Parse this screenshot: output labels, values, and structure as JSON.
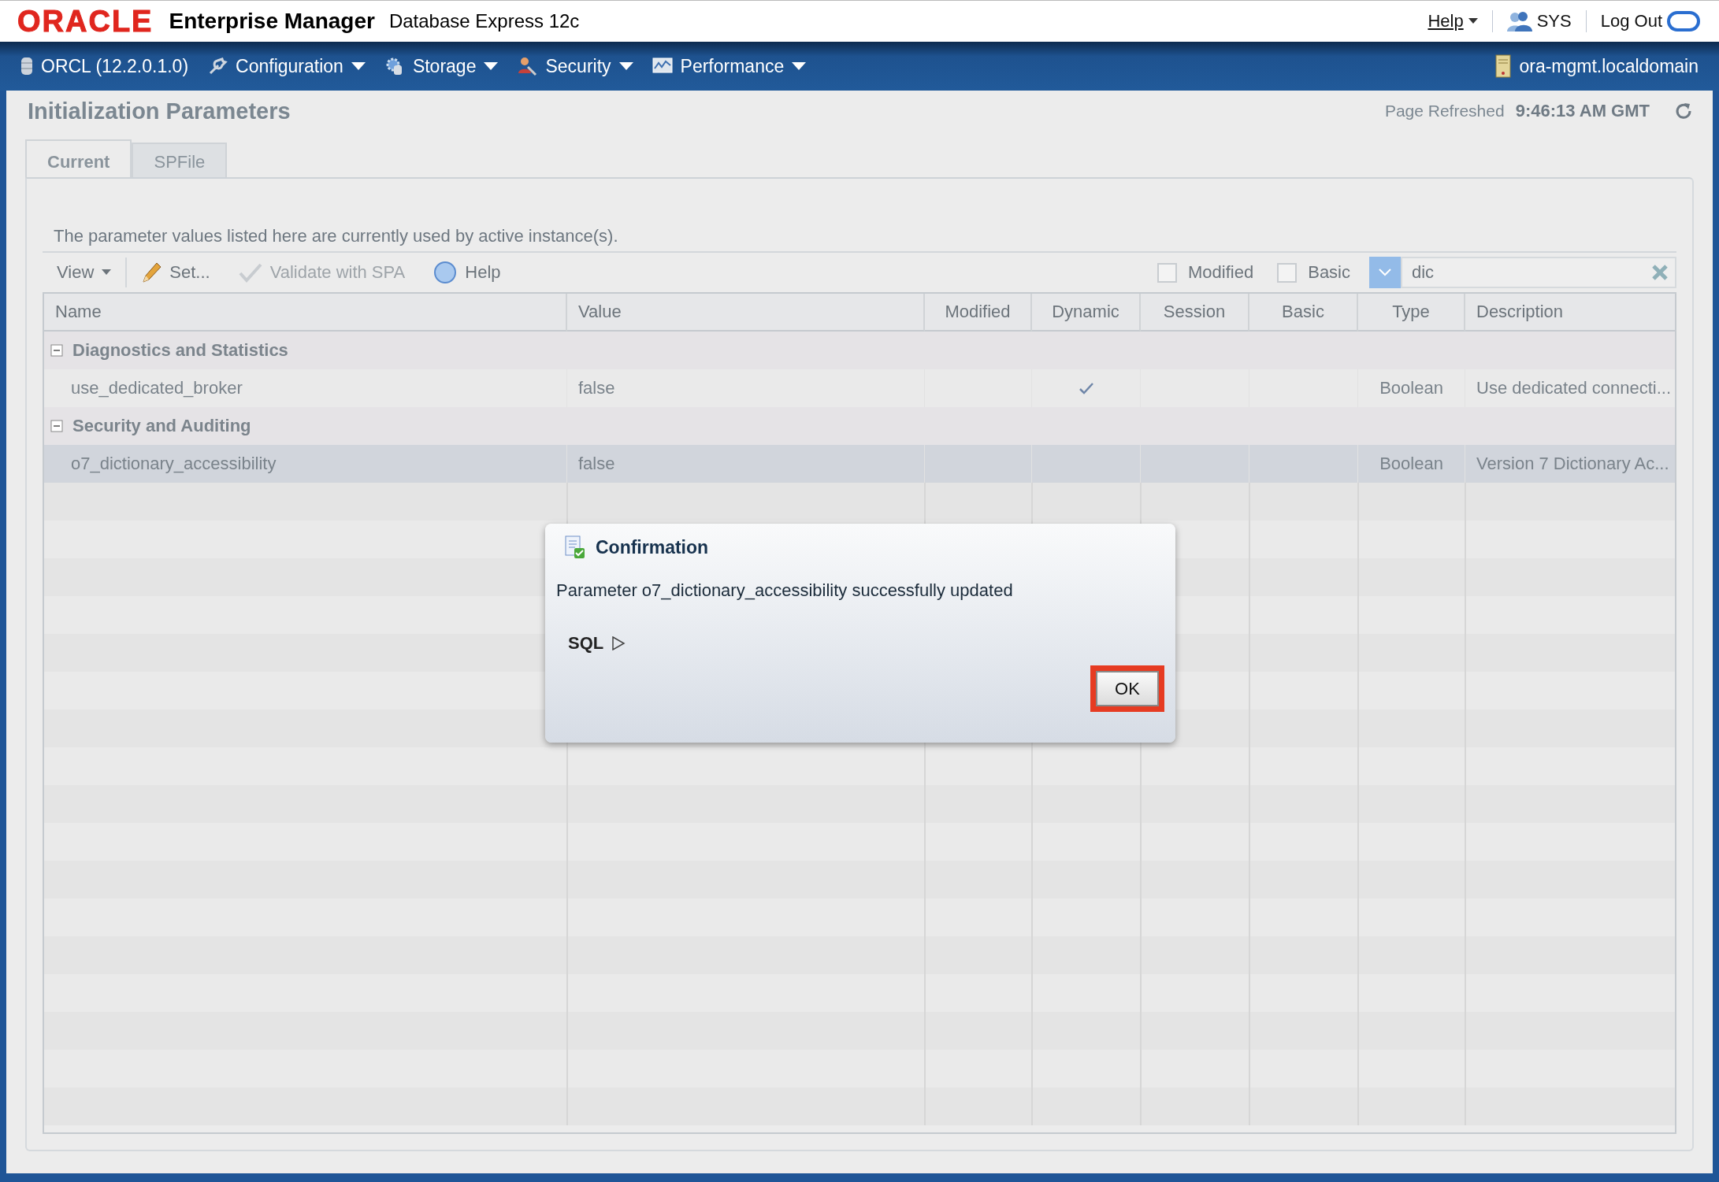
{
  "header": {
    "logo": "ORACLE",
    "product": "Enterprise Manager",
    "edition": "Database Express 12c",
    "help": "Help",
    "user": "SYS",
    "logout": "Log Out"
  },
  "nav": {
    "database": "ORCL (12.2.0.1.0)",
    "menus": [
      {
        "label": "Configuration",
        "kind": "wrench"
      },
      {
        "label": "Storage",
        "kind": "gear"
      },
      {
        "label": "Security",
        "kind": "people"
      },
      {
        "label": "Performance",
        "kind": "chart"
      }
    ],
    "host": "ora-mgmt.localdomain"
  },
  "page": {
    "title": "Initialization Parameters",
    "refreshed_label": "Page Refreshed",
    "refreshed_time": "9:46:13 AM GMT"
  },
  "tabs": [
    {
      "label": "Current",
      "selected": true
    },
    {
      "label": "SPFile",
      "selected": false
    }
  ],
  "info": "The parameter values listed here are currently used by active instance(s).",
  "toolbar": [
    {
      "label": "View",
      "kind": "menu",
      "disabled": false
    },
    {
      "label": "Set...",
      "kind": "pencil",
      "disabled": false
    },
    {
      "label": "Validate with SPA",
      "kind": "check",
      "disabled": true
    },
    {
      "label": "Help",
      "kind": "help",
      "disabled": false
    }
  ],
  "filters": [
    {
      "label": "Modified",
      "checked": false
    },
    {
      "label": "Basic",
      "checked": false
    }
  ],
  "search": {
    "value": "dic"
  },
  "table": {
    "columns": [
      "Name",
      "Value",
      "Modified",
      "Dynamic",
      "Session",
      "Basic",
      "Type",
      "Description"
    ],
    "groups": [
      {
        "label": "Diagnostics and Statistics",
        "expanded": true,
        "rows": [
          {
            "name": "use_dedicated_broker",
            "value": "false",
            "dynamic": true,
            "type": "Boolean",
            "description": "Use dedicated connecti...",
            "selected": false
          }
        ]
      },
      {
        "label": "Security and Auditing",
        "expanded": true,
        "rows": [
          {
            "name": "o7_dictionary_accessibility",
            "value": "false",
            "dynamic": false,
            "type": "Boolean",
            "description": "Version 7 Dictionary Ac...",
            "selected": true
          }
        ]
      }
    ]
  },
  "dialog": {
    "title": "Confirmation",
    "message": "Parameter o7_dictionary_accessibility successfully updated",
    "sql_label": "SQL",
    "expanded": false,
    "button": {
      "label": "OK",
      "highlighted": true
    }
  }
}
